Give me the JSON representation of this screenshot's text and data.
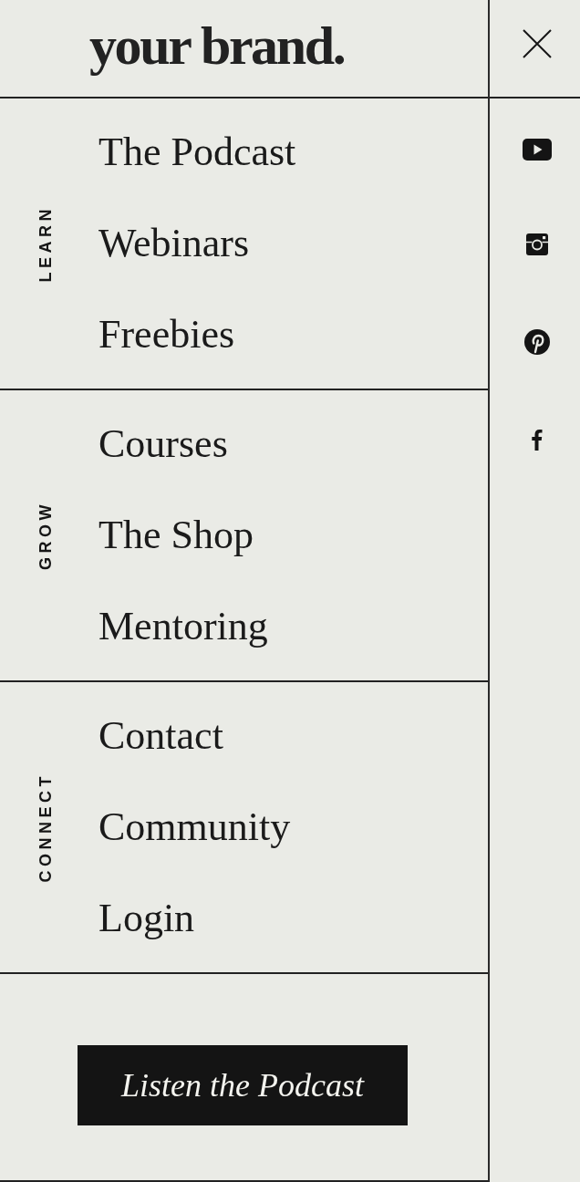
{
  "header": {
    "logo": "your brand."
  },
  "sections": [
    {
      "label": "LEARN",
      "items": [
        "The Podcast",
        "Webinars",
        "Freebies"
      ]
    },
    {
      "label": "GROW",
      "items": [
        "Courses",
        "The Shop",
        "Mentoring"
      ]
    },
    {
      "label": "CONNECT",
      "items": [
        "Contact",
        "Community",
        "Login"
      ]
    }
  ],
  "cta_button": {
    "label": "Listen the Podcast"
  }
}
